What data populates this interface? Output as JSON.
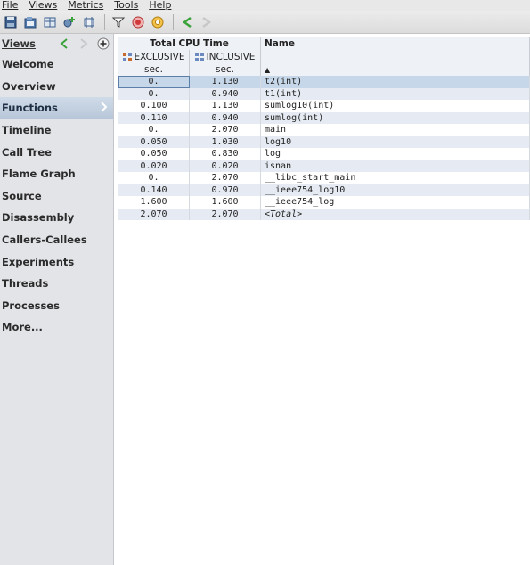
{
  "menubar": {
    "items": [
      "File",
      "Views",
      "Metrics",
      "Tools",
      "Help"
    ]
  },
  "toolbar": {
    "buttons": [
      "save-icon",
      "open-icon",
      "compare-icon",
      "add-experiment-icon",
      "settings-icon",
      "filter-icon",
      "record-icon",
      "gear-icon",
      "back-icon",
      "forward-icon"
    ]
  },
  "sidebar": {
    "title": "Views",
    "items": [
      {
        "label": "Welcome",
        "active": false
      },
      {
        "label": "Overview",
        "active": false
      },
      {
        "label": "Functions",
        "active": true
      },
      {
        "label": "Timeline",
        "active": false
      },
      {
        "label": "Call Tree",
        "active": false
      },
      {
        "label": "Flame Graph",
        "active": false
      },
      {
        "label": "Source",
        "active": false
      },
      {
        "label": "Disassembly",
        "active": false
      },
      {
        "label": "Callers-Callees",
        "active": false
      },
      {
        "label": "Experiments",
        "active": false
      },
      {
        "label": "Threads",
        "active": false
      },
      {
        "label": "Processes",
        "active": false
      },
      {
        "label": "More...",
        "active": false
      }
    ]
  },
  "table": {
    "group_header": "Total CPU Time",
    "name_header": "Name",
    "exclusive_label": "EXCLUSIVE",
    "inclusive_label": "INCLUSIVE",
    "unit": "sec.",
    "sort_indicator": "▲",
    "rows": [
      {
        "exclusive": "0.",
        "inclusive": "1.130",
        "name": "t2(int)"
      },
      {
        "exclusive": "0.",
        "inclusive": "0.940",
        "name": "t1(int)"
      },
      {
        "exclusive": "0.100",
        "inclusive": "1.130",
        "name": "sumlog10(int)"
      },
      {
        "exclusive": "0.110",
        "inclusive": "0.940",
        "name": "sumlog(int)"
      },
      {
        "exclusive": "0.",
        "inclusive": "2.070",
        "name": "main"
      },
      {
        "exclusive": "0.050",
        "inclusive": "1.030",
        "name": "log10"
      },
      {
        "exclusive": "0.050",
        "inclusive": "0.830",
        "name": "log"
      },
      {
        "exclusive": "0.020",
        "inclusive": "0.020",
        "name": "isnan"
      },
      {
        "exclusive": "0.",
        "inclusive": "2.070",
        "name": "__libc_start_main"
      },
      {
        "exclusive": "0.140",
        "inclusive": "0.970",
        "name": "__ieee754_log10"
      },
      {
        "exclusive": "1.600",
        "inclusive": "1.600",
        "name": "__ieee754_log"
      },
      {
        "exclusive": "2.070",
        "inclusive": "2.070",
        "name": "<Total>"
      }
    ]
  },
  "colors": {
    "sidebar_bg": "#e3e4e8",
    "selection": "#c7d7ea",
    "active_item": "#b6c6d8",
    "green_arrow": "#3aa23a"
  }
}
